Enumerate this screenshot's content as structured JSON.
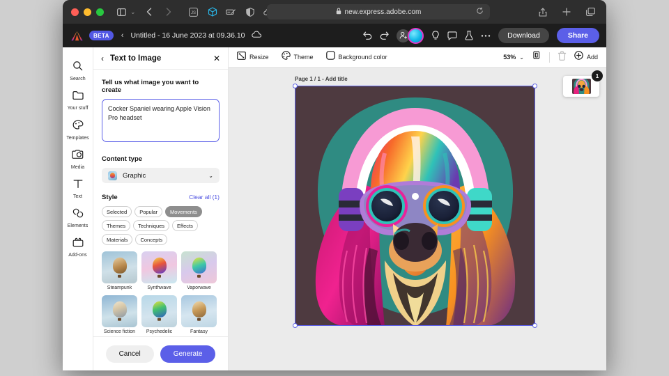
{
  "browser": {
    "url": "new.express.adobe.com",
    "lock_icon": "lock-icon",
    "reload_icon": "reload-icon",
    "sidebar_icon": "sidebar-toggle-icon",
    "back_icon": "back-arrow-icon",
    "forward_icon": "forward-arrow-icon",
    "extensions": [
      "js-extension-icon",
      "box-3d-extension-icon",
      "edit-extension-icon",
      "shield-extension-icon",
      "cloud-extension-icon"
    ],
    "right_icons": [
      "share-icon",
      "new-tab-icon",
      "tab-overview-icon"
    ]
  },
  "app_header": {
    "logo": "adobe-logo",
    "beta_badge": "BETA",
    "back_chevron": "back-chevron-icon",
    "document_title": "Untitled - 16 June 2023 at 09.36.10",
    "cloud_status_icon": "cloud-saved-icon",
    "undo_icon": "undo-icon",
    "redo_icon": "redo-icon",
    "invite_icon": "invite-user-icon",
    "avatar": "user-avatar",
    "help_icon": "lightbulb-icon",
    "comment_icon": "comment-icon",
    "experiment_icon": "beaker-icon",
    "more_icon": "more-options-icon",
    "download_label": "Download",
    "share_label": "Share"
  },
  "rail": {
    "items": [
      {
        "label": "Search",
        "icon": "search-icon"
      },
      {
        "label": "Your stuff",
        "icon": "folder-icon"
      },
      {
        "label": "Templates",
        "icon": "templates-icon"
      },
      {
        "label": "Media",
        "icon": "media-icon"
      },
      {
        "label": "Text",
        "icon": "text-icon"
      },
      {
        "label": "Elements",
        "icon": "elements-icon"
      },
      {
        "label": "Add-ons",
        "icon": "addons-icon"
      }
    ]
  },
  "panel": {
    "title": "Text to Image",
    "back_icon": "panel-back-icon",
    "close_icon": "panel-close-icon",
    "prompt_label": "Tell us what image you want to create",
    "prompt_value": "Cocker Spaniel wearing Apple Vision Pro headset",
    "content_type_label": "Content type",
    "content_type_value": "Graphic",
    "content_type_chevron": "chevron-down-icon",
    "style_label": "Style",
    "clear_all_label": "Clear all (1)",
    "chips": [
      {
        "label": "Selected",
        "active": false
      },
      {
        "label": "Popular",
        "active": false
      },
      {
        "label": "Movements",
        "active": true
      },
      {
        "label": "Themes",
        "active": false
      },
      {
        "label": "Techniques",
        "active": false
      },
      {
        "label": "Effects",
        "active": false
      },
      {
        "label": "Materials",
        "active": false
      },
      {
        "label": "Concepts",
        "active": false
      }
    ],
    "styles": [
      {
        "name": "Steampunk",
        "selected": false
      },
      {
        "name": "Synthwave",
        "selected": false
      },
      {
        "name": "Vaporwave",
        "selected": false
      },
      {
        "name": "Science fiction",
        "selected": false
      },
      {
        "name": "Psychedelic",
        "selected": false
      },
      {
        "name": "Fantasy",
        "selected": false
      },
      {
        "name": "",
        "selected": true
      },
      {
        "name": "",
        "selected": false
      },
      {
        "name": "",
        "selected": false
      }
    ],
    "cancel_label": "Cancel",
    "generate_label": "Generate"
  },
  "canvas": {
    "resize_label": "Resize",
    "resize_icon": "resize-icon",
    "theme_label": "Theme",
    "theme_icon": "theme-palette-icon",
    "background_color_label": "Background color",
    "background_color_icon": "background-color-icon",
    "zoom_level": "53%",
    "zoom_chevron": "chevron-down-icon",
    "pages_icon": "pages-icon",
    "delete_icon": "delete-icon",
    "add_label": "Add",
    "add_icon": "add-circle-icon",
    "page_label": "Page 1 / 1 - Add title",
    "page_badge": "1",
    "artwork_alt": "Pop-art Cocker Spaniel wearing headphones and goggles"
  },
  "colors": {
    "accent": "#5b5fe8",
    "beta_badge": "#5258e4",
    "canvas_bg": "#ebebeb",
    "art_bg": "#4e3a40",
    "art_blob": "#2f8b82"
  }
}
